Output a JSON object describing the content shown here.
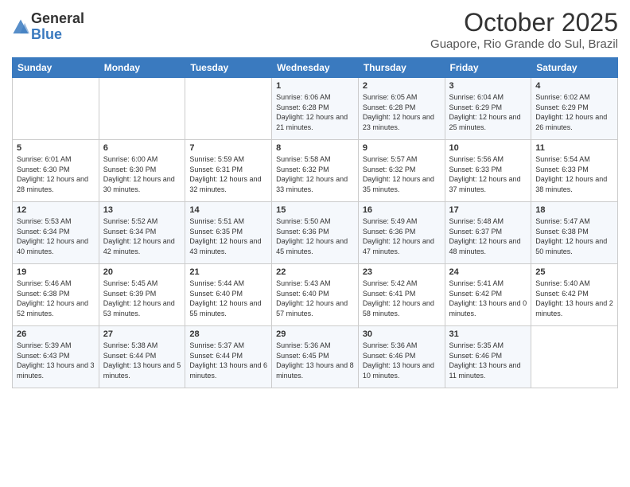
{
  "logo": {
    "general": "General",
    "blue": "Blue"
  },
  "header": {
    "month": "October 2025",
    "location": "Guapore, Rio Grande do Sul, Brazil"
  },
  "weekdays": [
    "Sunday",
    "Monday",
    "Tuesday",
    "Wednesday",
    "Thursday",
    "Friday",
    "Saturday"
  ],
  "weeks": [
    [
      {
        "day": "",
        "sunrise": "",
        "sunset": "",
        "daylight": ""
      },
      {
        "day": "",
        "sunrise": "",
        "sunset": "",
        "daylight": ""
      },
      {
        "day": "",
        "sunrise": "",
        "sunset": "",
        "daylight": ""
      },
      {
        "day": "1",
        "sunrise": "Sunrise: 6:06 AM",
        "sunset": "Sunset: 6:28 PM",
        "daylight": "Daylight: 12 hours and 21 minutes."
      },
      {
        "day": "2",
        "sunrise": "Sunrise: 6:05 AM",
        "sunset": "Sunset: 6:28 PM",
        "daylight": "Daylight: 12 hours and 23 minutes."
      },
      {
        "day": "3",
        "sunrise": "Sunrise: 6:04 AM",
        "sunset": "Sunset: 6:29 PM",
        "daylight": "Daylight: 12 hours and 25 minutes."
      },
      {
        "day": "4",
        "sunrise": "Sunrise: 6:02 AM",
        "sunset": "Sunset: 6:29 PM",
        "daylight": "Daylight: 12 hours and 26 minutes."
      }
    ],
    [
      {
        "day": "5",
        "sunrise": "Sunrise: 6:01 AM",
        "sunset": "Sunset: 6:30 PM",
        "daylight": "Daylight: 12 hours and 28 minutes."
      },
      {
        "day": "6",
        "sunrise": "Sunrise: 6:00 AM",
        "sunset": "Sunset: 6:30 PM",
        "daylight": "Daylight: 12 hours and 30 minutes."
      },
      {
        "day": "7",
        "sunrise": "Sunrise: 5:59 AM",
        "sunset": "Sunset: 6:31 PM",
        "daylight": "Daylight: 12 hours and 32 minutes."
      },
      {
        "day": "8",
        "sunrise": "Sunrise: 5:58 AM",
        "sunset": "Sunset: 6:32 PM",
        "daylight": "Daylight: 12 hours and 33 minutes."
      },
      {
        "day": "9",
        "sunrise": "Sunrise: 5:57 AM",
        "sunset": "Sunset: 6:32 PM",
        "daylight": "Daylight: 12 hours and 35 minutes."
      },
      {
        "day": "10",
        "sunrise": "Sunrise: 5:56 AM",
        "sunset": "Sunset: 6:33 PM",
        "daylight": "Daylight: 12 hours and 37 minutes."
      },
      {
        "day": "11",
        "sunrise": "Sunrise: 5:54 AM",
        "sunset": "Sunset: 6:33 PM",
        "daylight": "Daylight: 12 hours and 38 minutes."
      }
    ],
    [
      {
        "day": "12",
        "sunrise": "Sunrise: 5:53 AM",
        "sunset": "Sunset: 6:34 PM",
        "daylight": "Daylight: 12 hours and 40 minutes."
      },
      {
        "day": "13",
        "sunrise": "Sunrise: 5:52 AM",
        "sunset": "Sunset: 6:34 PM",
        "daylight": "Daylight: 12 hours and 42 minutes."
      },
      {
        "day": "14",
        "sunrise": "Sunrise: 5:51 AM",
        "sunset": "Sunset: 6:35 PM",
        "daylight": "Daylight: 12 hours and 43 minutes."
      },
      {
        "day": "15",
        "sunrise": "Sunrise: 5:50 AM",
        "sunset": "Sunset: 6:36 PM",
        "daylight": "Daylight: 12 hours and 45 minutes."
      },
      {
        "day": "16",
        "sunrise": "Sunrise: 5:49 AM",
        "sunset": "Sunset: 6:36 PM",
        "daylight": "Daylight: 12 hours and 47 minutes."
      },
      {
        "day": "17",
        "sunrise": "Sunrise: 5:48 AM",
        "sunset": "Sunset: 6:37 PM",
        "daylight": "Daylight: 12 hours and 48 minutes."
      },
      {
        "day": "18",
        "sunrise": "Sunrise: 5:47 AM",
        "sunset": "Sunset: 6:38 PM",
        "daylight": "Daylight: 12 hours and 50 minutes."
      }
    ],
    [
      {
        "day": "19",
        "sunrise": "Sunrise: 5:46 AM",
        "sunset": "Sunset: 6:38 PM",
        "daylight": "Daylight: 12 hours and 52 minutes."
      },
      {
        "day": "20",
        "sunrise": "Sunrise: 5:45 AM",
        "sunset": "Sunset: 6:39 PM",
        "daylight": "Daylight: 12 hours and 53 minutes."
      },
      {
        "day": "21",
        "sunrise": "Sunrise: 5:44 AM",
        "sunset": "Sunset: 6:40 PM",
        "daylight": "Daylight: 12 hours and 55 minutes."
      },
      {
        "day": "22",
        "sunrise": "Sunrise: 5:43 AM",
        "sunset": "Sunset: 6:40 PM",
        "daylight": "Daylight: 12 hours and 57 minutes."
      },
      {
        "day": "23",
        "sunrise": "Sunrise: 5:42 AM",
        "sunset": "Sunset: 6:41 PM",
        "daylight": "Daylight: 12 hours and 58 minutes."
      },
      {
        "day": "24",
        "sunrise": "Sunrise: 5:41 AM",
        "sunset": "Sunset: 6:42 PM",
        "daylight": "Daylight: 13 hours and 0 minutes."
      },
      {
        "day": "25",
        "sunrise": "Sunrise: 5:40 AM",
        "sunset": "Sunset: 6:42 PM",
        "daylight": "Daylight: 13 hours and 2 minutes."
      }
    ],
    [
      {
        "day": "26",
        "sunrise": "Sunrise: 5:39 AM",
        "sunset": "Sunset: 6:43 PM",
        "daylight": "Daylight: 13 hours and 3 minutes."
      },
      {
        "day": "27",
        "sunrise": "Sunrise: 5:38 AM",
        "sunset": "Sunset: 6:44 PM",
        "daylight": "Daylight: 13 hours and 5 minutes."
      },
      {
        "day": "28",
        "sunrise": "Sunrise: 5:37 AM",
        "sunset": "Sunset: 6:44 PM",
        "daylight": "Daylight: 13 hours and 6 minutes."
      },
      {
        "day": "29",
        "sunrise": "Sunrise: 5:36 AM",
        "sunset": "Sunset: 6:45 PM",
        "daylight": "Daylight: 13 hours and 8 minutes."
      },
      {
        "day": "30",
        "sunrise": "Sunrise: 5:36 AM",
        "sunset": "Sunset: 6:46 PM",
        "daylight": "Daylight: 13 hours and 10 minutes."
      },
      {
        "day": "31",
        "sunrise": "Sunrise: 5:35 AM",
        "sunset": "Sunset: 6:46 PM",
        "daylight": "Daylight: 13 hours and 11 minutes."
      },
      {
        "day": "",
        "sunrise": "",
        "sunset": "",
        "daylight": ""
      }
    ]
  ]
}
